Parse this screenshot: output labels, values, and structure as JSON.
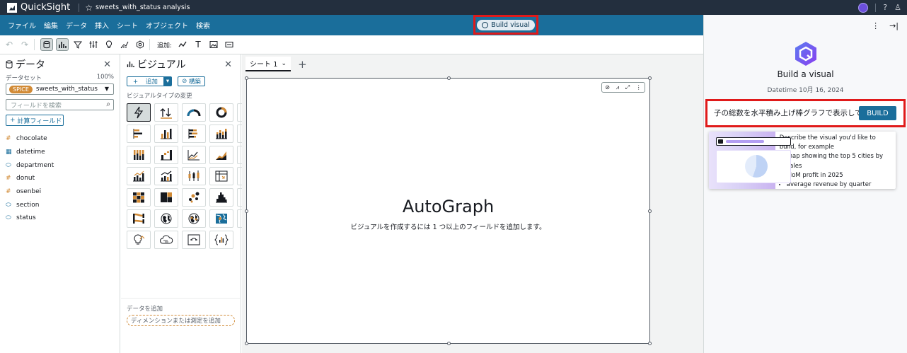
{
  "topbar": {
    "app_name": "QuickSight",
    "analysis_name": "sweets_with_status analysis"
  },
  "menu": {
    "items": [
      "ファイル",
      "編集",
      "データ",
      "挿入",
      "シート",
      "オブジェクト",
      "検索"
    ],
    "build_visual_label": "Build visual"
  },
  "toolbar": {
    "add_label": "追加:"
  },
  "data_panel": {
    "title": "データ",
    "dataset_label": "データセット",
    "dataset_percent": "100%",
    "spice_badge": "SPICE",
    "dataset_name": "sweets_with_status",
    "search_placeholder": "フィールドを検索",
    "calc_field_label": "計算フィールド",
    "fields": [
      {
        "name": "chocolate",
        "icon": "#"
      },
      {
        "name": "datetime",
        "icon": "date"
      },
      {
        "name": "department",
        "icon": "dim"
      },
      {
        "name": "donut",
        "icon": "#"
      },
      {
        "name": "osenbei",
        "icon": "#"
      },
      {
        "name": "section",
        "icon": "dim"
      },
      {
        "name": "status",
        "icon": "dim"
      }
    ]
  },
  "visuals_panel": {
    "title": "ビジュアル",
    "add_label": "追加",
    "layout_label": "構築",
    "change_type_label": "ビジュアルタイプの変更",
    "add_data_label": "データを追加",
    "drop_zone_label": "ディメンションまたは測定を追加"
  },
  "canvas": {
    "sheet_tab": "シート 1",
    "visual_title": "AutoGraph",
    "visual_subtitle": "ビジュアルを作成するには 1 つ以上のフィールドを追加します。"
  },
  "q_panel": {
    "title": "Build a visual",
    "date": "Datetime 10月 16, 2024",
    "prompt_value": "子の総数を水平積み上げ棒グラフで表示して",
    "build_button": "BUILD",
    "example_heading": "Describe the visual you'd like to build, for example",
    "examples": [
      "map showing the top 5 cities by sales",
      "MoM profit in 2025",
      "average revenue by quarter"
    ]
  },
  "colors": {
    "menubar": "#1a6e9b",
    "topbar": "#232f3e",
    "highlight_red": "#e01a1a",
    "spice": "#d18a35",
    "ai_purple": "#6b4fdc"
  }
}
